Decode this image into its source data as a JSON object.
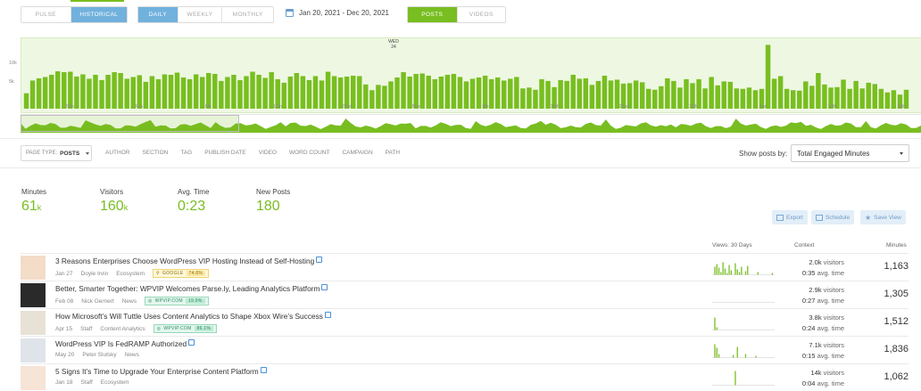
{
  "mode_tabs": [
    {
      "label": "PULSE",
      "active": false
    },
    {
      "label": "HISTORICAL",
      "active": true
    }
  ],
  "period_tabs": [
    {
      "label": "DAILY",
      "active": true
    },
    {
      "label": "WEEKLY",
      "active": false
    },
    {
      "label": "MONTHLY",
      "active": false
    }
  ],
  "date_range": "Jan 20, 2021 - Dec 20, 2021",
  "content_tabs": [
    {
      "label": "POSTS",
      "active": true
    },
    {
      "label": "VIDEOS",
      "active": false
    }
  ],
  "colors": {
    "accent_green": "#78be20",
    "accent_blue": "#71b1dd"
  },
  "chart": {
    "y_ticks": [
      "10k",
      "5k"
    ],
    "marker": {
      "line1": "WED",
      "line2": "24"
    },
    "x_ticks": [
      "25th",
      "Feb",
      "8th",
      "15th",
      "22nd",
      "Mar",
      "8th",
      "15th",
      "22nd",
      "29th",
      "Apr",
      "12th",
      "19th"
    ],
    "values": [
      3.5,
      6.4,
      6.9,
      7.2,
      7.7,
      8.5,
      8.3,
      8.4,
      7.3,
      7.8,
      6.8,
      7.7,
      6.5,
      7.7,
      8.3,
      8.1,
      6.8,
      7.2,
      7.6,
      6.1,
      7.4,
      6.7,
      7.8,
      7.7,
      8.2,
      7.1,
      6.7,
      7.8,
      7.2,
      8.1,
      7.9,
      6.3,
      7.2,
      7.7,
      6.5,
      7.4,
      8.4,
      7.7,
      7.0,
      8.3,
      6.7,
      5.9,
      7.3,
      8.1,
      7.4,
      6.5,
      7.4,
      6.4,
      8.4,
      7.4,
      7.1,
      7.3,
      7.5,
      7.4,
      5.5,
      4.2,
      5.4,
      5.2,
      6.2,
      7.1,
      8.3,
      7.3,
      7.9,
      8.0,
      7.5,
      6.7,
      7.3,
      7.7,
      7.9,
      7.2,
      6.2,
      6.8,
      7.1,
      7.5,
      6.7,
      7.1,
      6.4,
      6.8,
      7.2,
      4.6,
      4.8,
      4.3,
      6.7,
      6.3,
      4.9,
      6.5,
      6.3,
      7.7,
      6.8,
      6.9,
      5.4,
      6.3,
      7.5,
      6.4,
      6.6,
      5.7,
      5.8,
      6.4,
      6.0,
      4.5,
      4.3,
      5.1,
      6.9,
      6.3,
      4.8,
      6.7,
      5.8,
      6.7,
      4.6,
      7.2,
      5.3,
      6.2,
      6.1,
      4.6,
      4.5,
      4.8,
      4.2,
      4.5,
      14.5,
      6.8,
      7.4,
      4.5,
      4.2,
      4.1,
      6.2,
      5.2,
      8.1,
      5.5,
      4.8,
      4.9,
      6.6,
      4.5,
      6.3,
      4.6,
      5.9,
      5.6,
      4.5,
      3.7,
      4.2,
      3.2,
      4.3
    ]
  },
  "filters": {
    "page_type_label": "PAGE TYPE:",
    "page_type_value": "POSTS",
    "items": [
      "AUTHOR",
      "SECTION",
      "TAG",
      "PUBLISH DATE",
      "VIDEO",
      "WORD COUNT",
      "CAMPAIGN",
      "PATH"
    ],
    "show_label": "Show posts by:",
    "show_value": "Total Engaged Minutes"
  },
  "stats": [
    {
      "label": "Minutes",
      "value": "61",
      "suffix": "k"
    },
    {
      "label": "Visitors",
      "value": "160",
      "suffix": "k"
    },
    {
      "label": "Avg. Time",
      "value": "0:23",
      "suffix": ""
    },
    {
      "label": "New Posts",
      "value": "180",
      "suffix": ""
    }
  ],
  "actions": {
    "export": "Export",
    "schedule": "Schedule",
    "save_view": "Save View"
  },
  "table_headers": {
    "views": "Views: 30 Days",
    "context": "Context",
    "minutes": "Minutes"
  },
  "posts": [
    {
      "title": "3 Reasons Enterprises Choose WordPress VIP Hosting Instead of Self-Hosting",
      "date": "Jan 27",
      "author": "Doyle Irvin",
      "section": "Ecosystem",
      "referrer": {
        "name": "GOOGLE",
        "pct": "74.6%",
        "kind": "g"
      },
      "visitors": "2.0k",
      "avg_time": "0:35",
      "minutes": "1,163",
      "spark": [
        0,
        9,
        12,
        8,
        3,
        14,
        7,
        2,
        11,
        5,
        0,
        13,
        6,
        3,
        9,
        0,
        4,
        10,
        0,
        0,
        0,
        0,
        3,
        0,
        0,
        0,
        0,
        0,
        0,
        2
      ]
    },
    {
      "title": "Better, Smarter Together: WPVIP Welcomes Parse.ly, Leading Analytics Platform",
      "date": "Feb 08",
      "author": "Nick Gernert",
      "section": "News",
      "referrer": {
        "name": "WPVIP.COM",
        "pct": "19.9%",
        "kind": "w"
      },
      "visitors": "2.9k",
      "avg_time": "0:27",
      "minutes": "1,305",
      "spark": [
        0,
        0,
        0,
        0,
        0,
        0,
        0,
        0,
        0,
        0,
        0,
        0,
        0,
        0,
        0,
        0,
        0,
        0,
        0,
        0,
        0,
        0,
        0,
        0,
        0,
        0,
        0,
        0,
        0,
        0
      ]
    },
    {
      "title": "How Microsoft’s Will Tuttle Uses Content Analytics to Shape Xbox Wire’s Success",
      "date": "Apr 15",
      "author": "Staff",
      "section": "Content Analytics",
      "referrer": {
        "name": "WPVIP.COM",
        "pct": "86.1%",
        "kind": "w"
      },
      "visitors": "3.8k",
      "avg_time": "0:24",
      "minutes": "1,512",
      "spark": [
        0,
        14,
        3,
        0,
        0,
        0,
        0,
        0,
        0,
        0,
        0,
        0,
        0,
        0,
        0,
        0,
        0,
        0,
        0,
        0,
        0,
        0,
        0,
        0,
        0,
        0,
        0,
        0,
        0,
        0
      ]
    },
    {
      "title": "WordPress VIP Is FedRAMP Authorized",
      "date": "May 20",
      "author": "Peter Slutsky",
      "section": "News",
      "referrer": null,
      "visitors": "7.1k",
      "avg_time": "0:15",
      "minutes": "1,836",
      "spark": [
        0,
        15,
        11,
        4,
        0,
        0,
        0,
        0,
        0,
        0,
        3,
        0,
        12,
        0,
        0,
        0,
        4,
        0,
        0,
        0,
        0,
        2,
        0,
        0,
        0,
        0,
        0,
        0,
        0,
        0
      ]
    },
    {
      "title": "5 Signs It’s Time to Upgrade Your Enterprise Content Platform",
      "date": "Jan 18",
      "author": "Staff",
      "section": "Ecosystem",
      "referrer": null,
      "visitors": "14k",
      "avg_time": "0:04",
      "minutes": "1,062",
      "spark": [
        0,
        0,
        0,
        0,
        0,
        0,
        0,
        0,
        0,
        0,
        0,
        16,
        0,
        0,
        0,
        0,
        0,
        0,
        0,
        0,
        0,
        0,
        0,
        0,
        0,
        0,
        0,
        0,
        0,
        0
      ]
    }
  ],
  "labels": {
    "visitors_suffix": "visitors",
    "avg_time_suffix": "avg. time"
  }
}
